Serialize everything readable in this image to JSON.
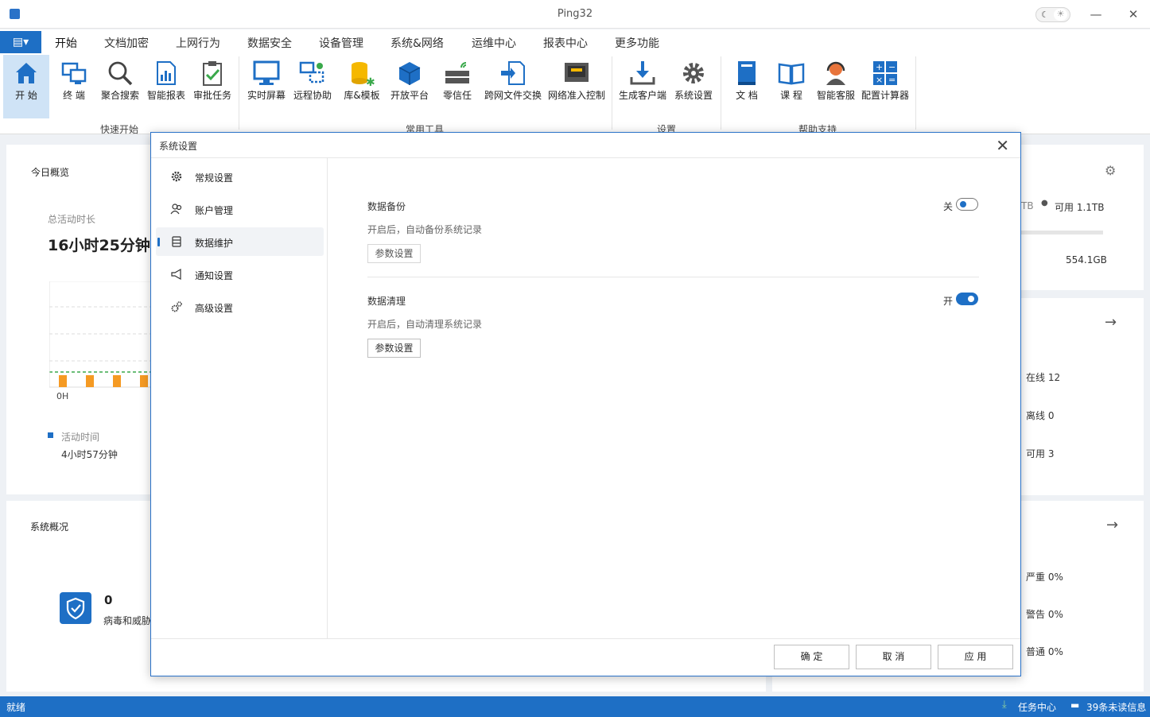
{
  "window": {
    "title": "Ping32"
  },
  "menu": {
    "tabs": [
      "开始",
      "文档加密",
      "上网行为",
      "数据安全",
      "设备管理",
      "系统&网络",
      "运维中心",
      "报表中心",
      "更多功能"
    ]
  },
  "ribbon": {
    "items": [
      {
        "label": "开 始"
      },
      {
        "label": "终 端"
      },
      {
        "label": "聚合搜索"
      },
      {
        "label": "智能报表"
      },
      {
        "label": "审批任务"
      },
      {
        "label": "实时屏幕"
      },
      {
        "label": "远程协助"
      },
      {
        "label": "库&模板"
      },
      {
        "label": "开放平台"
      },
      {
        "label": "零信任"
      },
      {
        "label": "跨网文件交换"
      },
      {
        "label": "网络准入控制"
      },
      {
        "label": "生成客户端"
      },
      {
        "label": "系统设置"
      },
      {
        "label": "文 档"
      },
      {
        "label": "课 程"
      },
      {
        "label": "智能客服"
      },
      {
        "label": "配置计算器"
      }
    ],
    "groups": [
      "快速开始",
      "常用工具",
      "设置",
      "帮助支持"
    ]
  },
  "dashboard": {
    "today_title": "今日概览",
    "total_active_label": "总活动时长",
    "total_active_value": "16小时25分钟",
    "chart_x0": "0H",
    "legend_label": "活动时间",
    "legend_value": "4小时57分钟",
    "system_title": "系统概况",
    "virus_count": "0",
    "virus_label": "病毒和威胁",
    "disk_tb_suffix": "TB",
    "disk_available": "可用 1.1TB",
    "disk_value": "554.1GB",
    "online": "在线  12",
    "offline": "离线  0",
    "available": "可用  3",
    "severe": "严重  0%",
    "warning": "警告  0%",
    "normal": "普通  0%"
  },
  "modal": {
    "title": "系统设置",
    "sidebar": [
      {
        "label": "常规设置"
      },
      {
        "label": "账户管理"
      },
      {
        "label": "数据维护"
      },
      {
        "label": "通知设置"
      },
      {
        "label": "高级设置"
      }
    ],
    "backup": {
      "title": "数据备份",
      "desc": "开启后，自动备份系统记录",
      "button": "参数设置",
      "toggle_label": "关"
    },
    "cleanup": {
      "title": "数据清理",
      "desc": "开启后，自动清理系统记录",
      "button": "参数设置",
      "toggle_label": "开"
    },
    "buttons": {
      "ok": "确 定",
      "cancel": "取 消",
      "apply": "应 用"
    }
  },
  "status": {
    "ready": "就绪",
    "task_center": "任务中心",
    "unread": "39条未读信息"
  }
}
